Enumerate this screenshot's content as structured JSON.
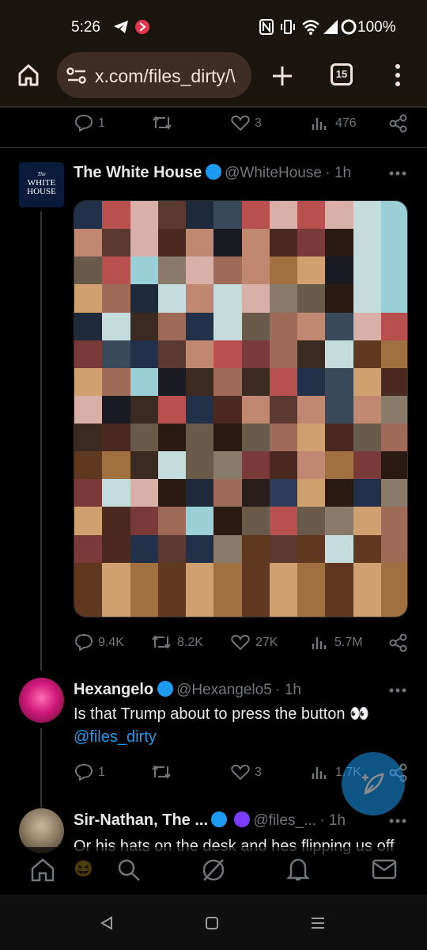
{
  "status_bar": {
    "time": "5:26",
    "battery": "100%"
  },
  "browser": {
    "url": "x.com/files_dirty/\\",
    "tab_count": "15"
  },
  "prev_actions": {
    "replies": "1",
    "reposts": "",
    "likes": "3",
    "views": "476"
  },
  "tweet1": {
    "name": "The White House",
    "handle": "@WhiteHouse",
    "time": "· 1h",
    "avatar_text": [
      "The",
      "WHITE",
      "HOUSE"
    ],
    "replies": "9.4K",
    "reposts": "8.2K",
    "likes": "27K",
    "views": "5.7M"
  },
  "reply1": {
    "name": "Hexangelo",
    "handle": "@Hexangelo5",
    "time": "· 1h",
    "text": "Is that Trump about to press the button 👀",
    "mention": "@files_dirty",
    "replies": "1",
    "reposts": "",
    "likes": "3",
    "views": "1.7K"
  },
  "reply2": {
    "name": "Sir-Nathan, The ...",
    "handle": "@files_...",
    "time": "· 1h",
    "text": "Or his hats on the desk and hes flipping us off 😆"
  },
  "colors": {
    "accent": "#1d9bf0",
    "background": "#000000",
    "muted": "#71767b"
  },
  "icons": [
    "home-icon",
    "site-settings-icon",
    "plus-icon",
    "tabs-icon",
    "menu-dots-icon",
    "reply-icon",
    "repost-icon",
    "like-icon",
    "views-icon",
    "share-icon",
    "more-icon",
    "verified-icon",
    "compose-icon",
    "search-icon",
    "grok-icon",
    "notifications-icon",
    "messages-icon"
  ]
}
